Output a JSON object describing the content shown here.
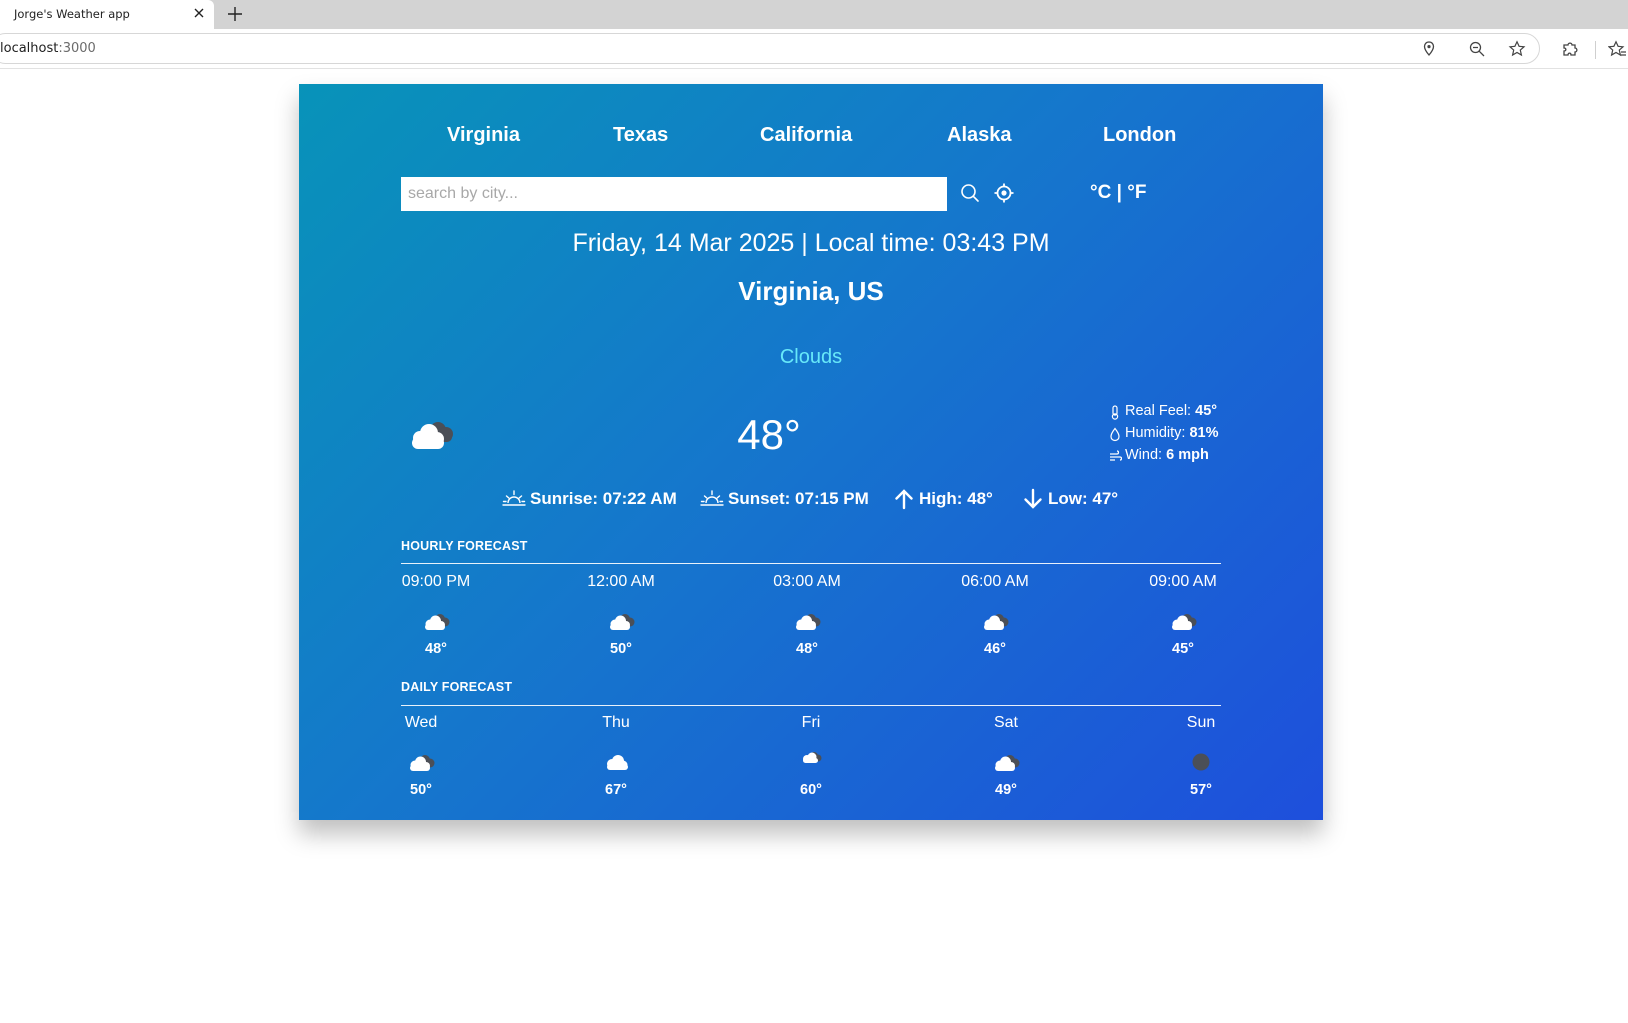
{
  "browser": {
    "tab_title": "Jorge's Weather app",
    "url_host": "localhost",
    "url_port": ":3000"
  },
  "cities": [
    {
      "label": "Virginia"
    },
    {
      "label": "Texas"
    },
    {
      "label": "California"
    },
    {
      "label": "Alaska"
    },
    {
      "label": "London"
    }
  ],
  "search": {
    "placeholder": "search by city...",
    "value": ""
  },
  "units": {
    "celsius": "°C",
    "separator": "|",
    "fahrenheit": "°F"
  },
  "current": {
    "datetime": "Friday, 14 Mar 2025 | Local time: 03:43 PM",
    "location": "Virginia, US",
    "condition": "Clouds",
    "condition_color": "#67e8f9",
    "temp": "48°",
    "icon": "broken-clouds-icon",
    "details": [
      {
        "label": "Real Feel:",
        "value": "45°",
        "icon": "thermometer-icon"
      },
      {
        "label": "Humidity:",
        "value": "81%",
        "icon": "droplet-icon"
      },
      {
        "label": "Wind:",
        "value": "6 mph",
        "icon": "wind-icon"
      }
    ],
    "sun": [
      {
        "text": "Sunrise: 07:22 AM",
        "icon": "sunrise-icon"
      },
      {
        "text": "Sunset: 07:15 PM",
        "icon": "sunset-icon"
      },
      {
        "text": "High: 48°",
        "icon": "arrow-up-icon"
      },
      {
        "text": "Low: 47°",
        "icon": "arrow-down-icon"
      }
    ]
  },
  "hourly": {
    "title": "HOURLY FORECAST",
    "items": [
      {
        "label": "09:00 PM",
        "temp": "48°",
        "icon": "broken-clouds-icon"
      },
      {
        "label": "12:00 AM",
        "temp": "50°",
        "icon": "broken-clouds-icon"
      },
      {
        "label": "03:00 AM",
        "temp": "48°",
        "icon": "broken-clouds-icon"
      },
      {
        "label": "06:00 AM",
        "temp": "46°",
        "icon": "broken-clouds-icon"
      },
      {
        "label": "09:00 AM",
        "temp": "45°",
        "icon": "broken-clouds-icon"
      }
    ]
  },
  "daily": {
    "title": "DAILY FORECAST",
    "items": [
      {
        "label": "Wed",
        "temp": "50°",
        "icon": "broken-clouds-icon"
      },
      {
        "label": "Thu",
        "temp": "67°",
        "icon": "cloud-icon"
      },
      {
        "label": "Fri",
        "temp": "60°",
        "icon": "small-clouds-icon"
      },
      {
        "label": "Sat",
        "temp": "49°",
        "icon": "broken-clouds-icon"
      },
      {
        "label": "Sun",
        "temp": "57°",
        "icon": "overcast-dot-icon"
      }
    ]
  },
  "colors": {
    "gradient_start": "#0893b9",
    "gradient_end": "#1e4fdc",
    "text": "#ffffff"
  }
}
